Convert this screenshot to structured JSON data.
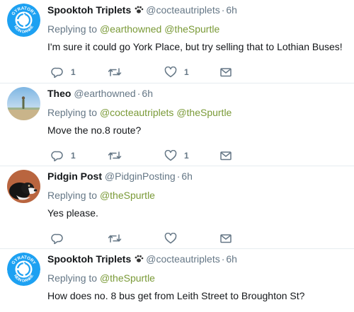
{
  "tweets": [
    {
      "name": "Spooktoh Triplets",
      "handle": "@cocteautriplets",
      "time": "6h",
      "replying_label": "Replying to",
      "replying_to": [
        "@earthowned",
        "@theSpurtle"
      ],
      "text": "I'm sure it could go York Place, but try selling that to Lothian Buses!",
      "reply_count": "1",
      "retweet_count": "",
      "like_count": "1",
      "avatar_text_top": "GYRATORY",
      "avatar_text_bottom": "NEIN DANKE"
    },
    {
      "name": "Theo",
      "handle": "@earthowned",
      "time": "6h",
      "replying_label": "Replying to",
      "replying_to": [
        "@cocteautriplets",
        "@theSpurtle"
      ],
      "text": "Move the no.8 route?",
      "reply_count": "1",
      "retweet_count": "",
      "like_count": "1"
    },
    {
      "name": "Pidgin Post",
      "handle": "@PidginPosting",
      "time": "6h",
      "replying_label": "Replying to",
      "replying_to": [
        "@theSpurtle"
      ],
      "text": "Yes please.",
      "reply_count": "",
      "retweet_count": "",
      "like_count": ""
    },
    {
      "name": "Spooktoh Triplets",
      "handle": "@cocteautriplets",
      "time": "6h",
      "replying_label": "Replying to",
      "replying_to": [
        "@theSpurtle"
      ],
      "text": "How does no. 8 bus get from Leith Street to Broughton St?",
      "avatar_text_top": "GYRATORY",
      "avatar_text_bottom": "NEIN DANKE"
    }
  ],
  "separator": "·",
  "colors": {
    "link": "#7a9a37",
    "muted": "#657786",
    "text": "#14171a",
    "avatar_logo": "#1da1f2"
  },
  "icons": {
    "reply": "reply-icon",
    "retweet": "retweet-icon",
    "like": "heart-icon",
    "dm": "envelope-icon"
  }
}
